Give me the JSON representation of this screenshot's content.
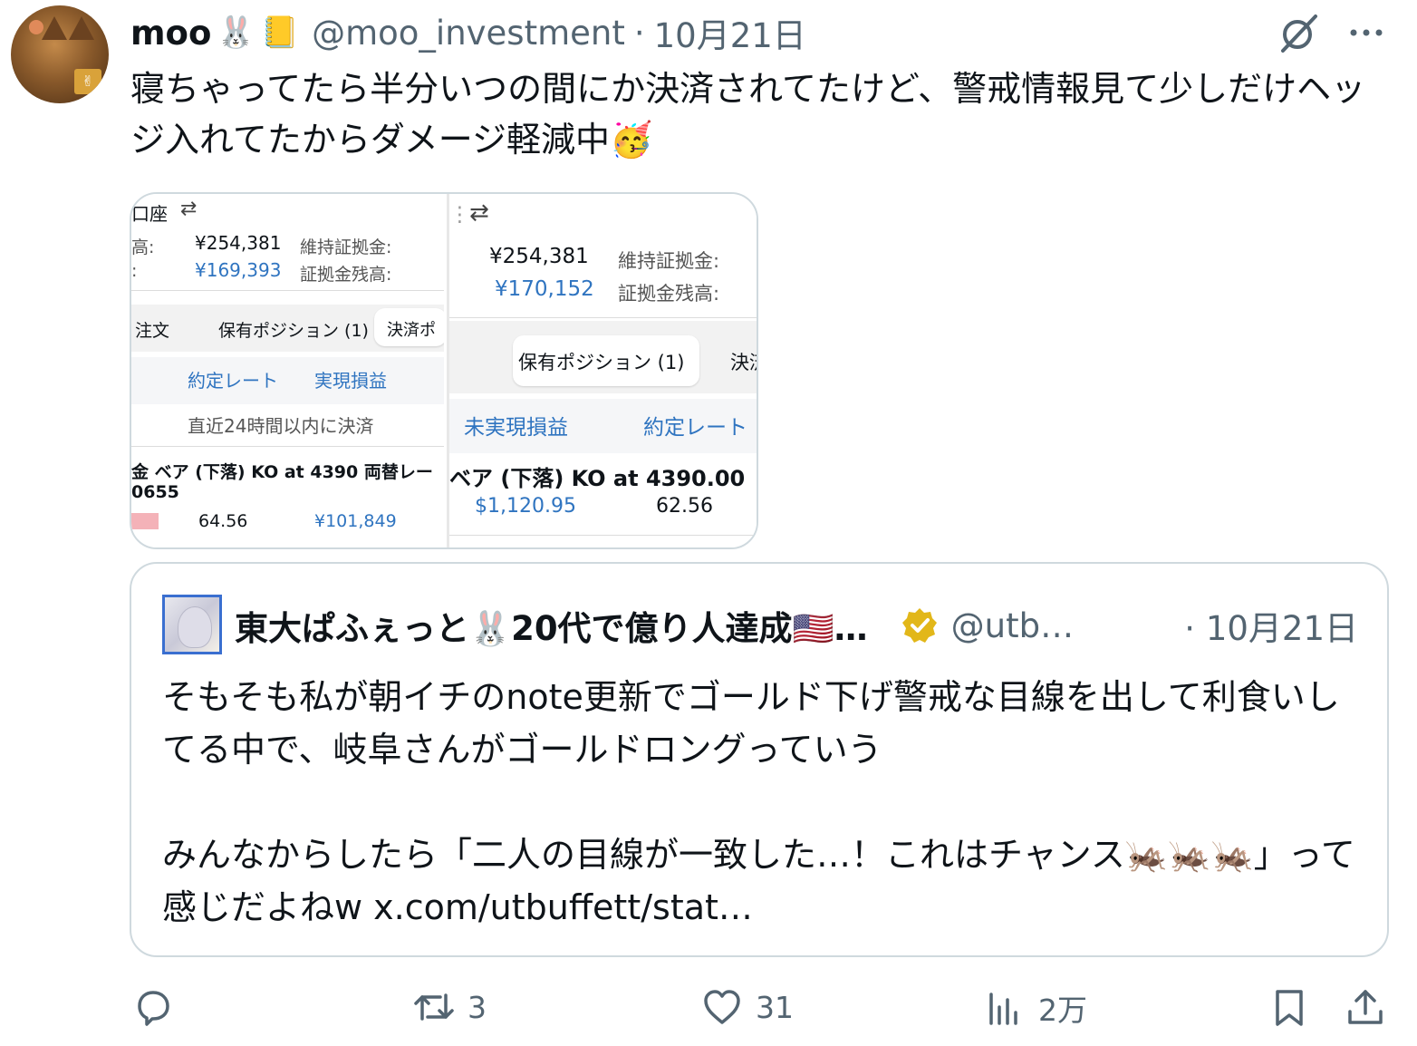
{
  "tweet": {
    "author_name": "moo",
    "author_emojis": [
      "rabbit-emoji",
      "notebook-emoji"
    ],
    "handle": "@moo_investment",
    "separator": "·",
    "date": "10月21日",
    "text": "寝ちゃってたら半分いつの間にか決済されてたけど、警戒情報見て少しだけヘッジ入れてたからダメージ軽減中🥳",
    "icons": [
      "grok-icon",
      "more-icon"
    ]
  },
  "media": {
    "image1": {
      "top_label": "口座",
      "row1_label": "高:",
      "row1_value": "¥254,381",
      "row1_right": "維持証拠金:",
      "row2_label": ":",
      "row2_value": "¥169,393",
      "row2_right": "証拠金残高:",
      "tab1": "注文",
      "tab2": "保有ポジション (1)",
      "tab3": "決済ポ",
      "col1": "約定レート",
      "col2": "実現損益",
      "note": "直近24時間以内に決済",
      "product": "金 ベア (下落) KO at 4390 両替レー",
      "product2": "0655",
      "rate": "64.56",
      "pnl": "¥101,849"
    },
    "image2": {
      "row1_value": "¥254,381",
      "row1_right": "維持証拠金:",
      "row2_value": "¥170,152",
      "row2_right": "証拠金残高:",
      "tab_active": "保有ポジション (1)",
      "tab_next": "決済",
      "col1": "未実現損益",
      "col2": "約定レート",
      "product": "ベア (下落) KO at 4390.00",
      "pnl": "$1,120.95",
      "rate": "62.56"
    }
  },
  "quote": {
    "author_name": "東大ぱふぇっと🐰20代で億り人達成🇺🇸…",
    "handle": "@utb…",
    "separator": "·",
    "date": "10月21日",
    "text": "そもそも私が朝イチのnote更新でゴールド下げ警戒な目線を出して利食いしてる中で、岐阜さんがゴールドロングっていう\n\nみんなからしたら「二人の目線が一致した…！これはチャンス🦗🦗🦗」って感じだよねw x.com/utbuffett/stat…"
  },
  "actions": {
    "reply_count": "",
    "retweet_count": "3",
    "like_count": "31",
    "views_count": "2万"
  },
  "colors": {
    "text": "#0f1419",
    "secondary": "#536471",
    "border": "#cfd9de",
    "blue_value": "#2f74c0",
    "verified_gold": "#e2b719"
  }
}
